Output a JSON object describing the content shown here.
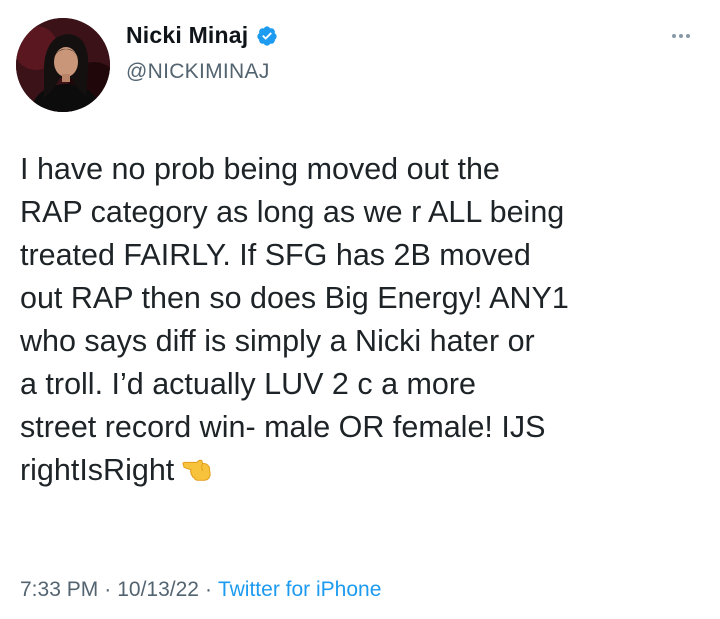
{
  "author": {
    "display_name": "Nicki Minaj",
    "handle": "@NICKIMINAJ",
    "verified": true,
    "verified_color": "#1d9bf0"
  },
  "tweet": {
    "text": "I have no prob being moved out the\nRAP category as long as we r ALL being\ntreated FAIRLY. If SFG has 2B moved\nout RAP then so does Big Energy! ANY1\nwho says diff is simply a Nicki hater or\na troll. I’d actually LUV 2 c a more\nstreet record win- male OR female! IJS\nrightIsRight",
    "trailing_emoji": "backhand-index-pointing-left-icon"
  },
  "meta": {
    "time": "7:33 PM",
    "separator": "·",
    "date": "10/13/22",
    "source": "Twitter for iPhone"
  },
  "icons": {
    "more": "more-options-icon"
  },
  "colors": {
    "text": "#0f1419",
    "secondary": "#536471",
    "link": "#1d9bf0",
    "background": "#ffffff"
  }
}
